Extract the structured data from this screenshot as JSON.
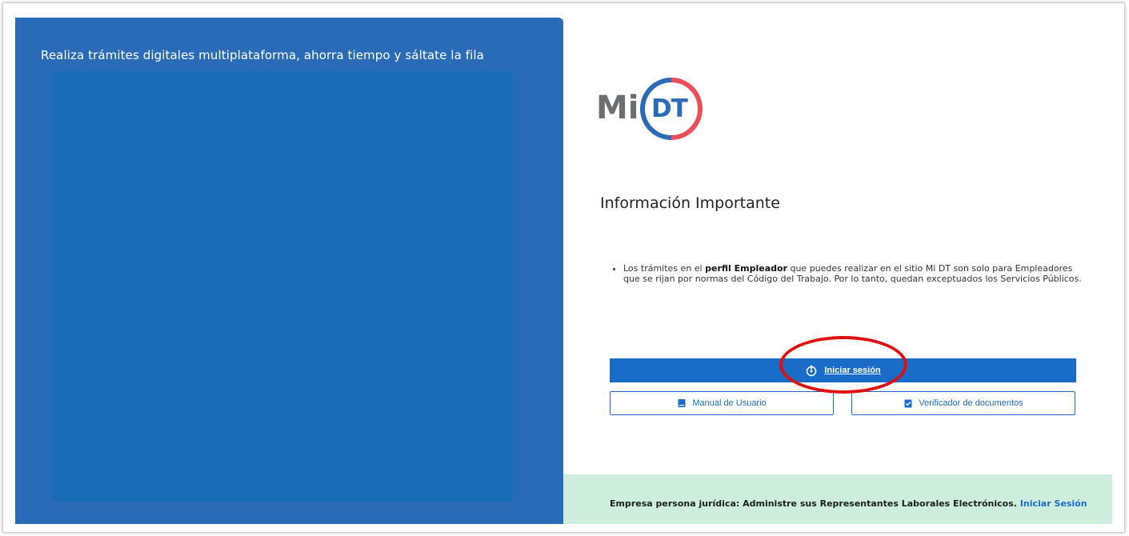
{
  "left_panel": {
    "tagline": "Realiza trámites digitales multiplataforma, ahorra tiempo y sáltate la fila"
  },
  "logo": {
    "mi": "Mi",
    "dt": "DT"
  },
  "heading": "Información Importante",
  "info": {
    "prefix": "Los trámites en el ",
    "bold": "perfil Empleador",
    "suffix": " que puedes realizar en el sitio Mi DT son solo para Empleadores que se rijan por normas del Código del Trabajo. Por lo tanto, quedan exceptuados los Servicios Públicos."
  },
  "buttons": {
    "login": "Iniciar sesión",
    "manual": "Manual de Usuario",
    "verifier": "Verificador de documentos"
  },
  "footer": {
    "text": "Empresa persona jurídica: Administre sus Representantes Laborales Electrónicos.",
    "link": "Iniciar Sesión"
  },
  "icons": {
    "login": "power-icon",
    "manual": "book-icon",
    "verifier": "clipboard-check-icon"
  },
  "colors": {
    "primary": "#196cc8",
    "panel": "#2a6bb8",
    "footer_bg": "#cdeedd",
    "annotation": "#e01010"
  }
}
